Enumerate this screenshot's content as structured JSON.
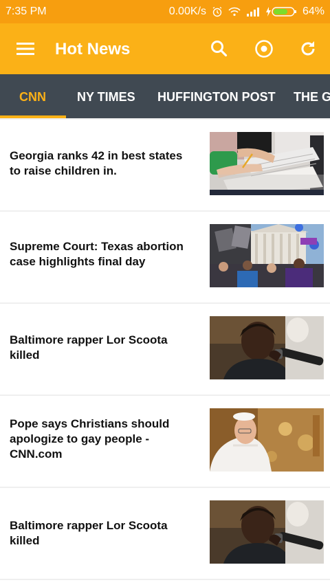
{
  "status": {
    "time": "7:35 PM",
    "net_speed": "0.00K/s",
    "battery": "64%",
    "alarm_icon": "alarm-clock-icon",
    "wifi_icon": "wifi-icon",
    "signal_icon": "cell-signal-icon",
    "battery_icon": "battery-charging-icon"
  },
  "app_bar": {
    "title": "Hot News",
    "menu_icon": "hamburger-menu-icon",
    "search_icon": "search-icon",
    "target_icon": "target-icon",
    "refresh_icon": "refresh-icon"
  },
  "tabs": [
    {
      "label": "CNN",
      "active": true
    },
    {
      "label": "NY TIMES",
      "active": false
    },
    {
      "label": "HUFFINGTON POST",
      "active": false
    },
    {
      "label": "THE G",
      "active": false
    }
  ],
  "articles": [
    {
      "headline": "Georgia ranks 42 in best states to raise children in.",
      "thumbnail": "students-writing-photo"
    },
    {
      "headline": "Supreme Court: Texas abortion case highlights final day",
      "thumbnail": "supreme-court-protest-photo"
    },
    {
      "headline": "Baltimore rapper Lor Scoota killed",
      "thumbnail": "young-man-microphone-photo"
    },
    {
      "headline": "Pope says Christians should apologize to gay people - CNN.com",
      "thumbnail": "pope-photo"
    },
    {
      "headline": "Baltimore rapper Lor Scoota killed",
      "thumbnail": "young-man-microphone-photo"
    }
  ],
  "colors": {
    "status_bar": "#f79e0f",
    "app_bar": "#fbb117",
    "tab_bar": "#404952",
    "accent": "#fbb117"
  }
}
